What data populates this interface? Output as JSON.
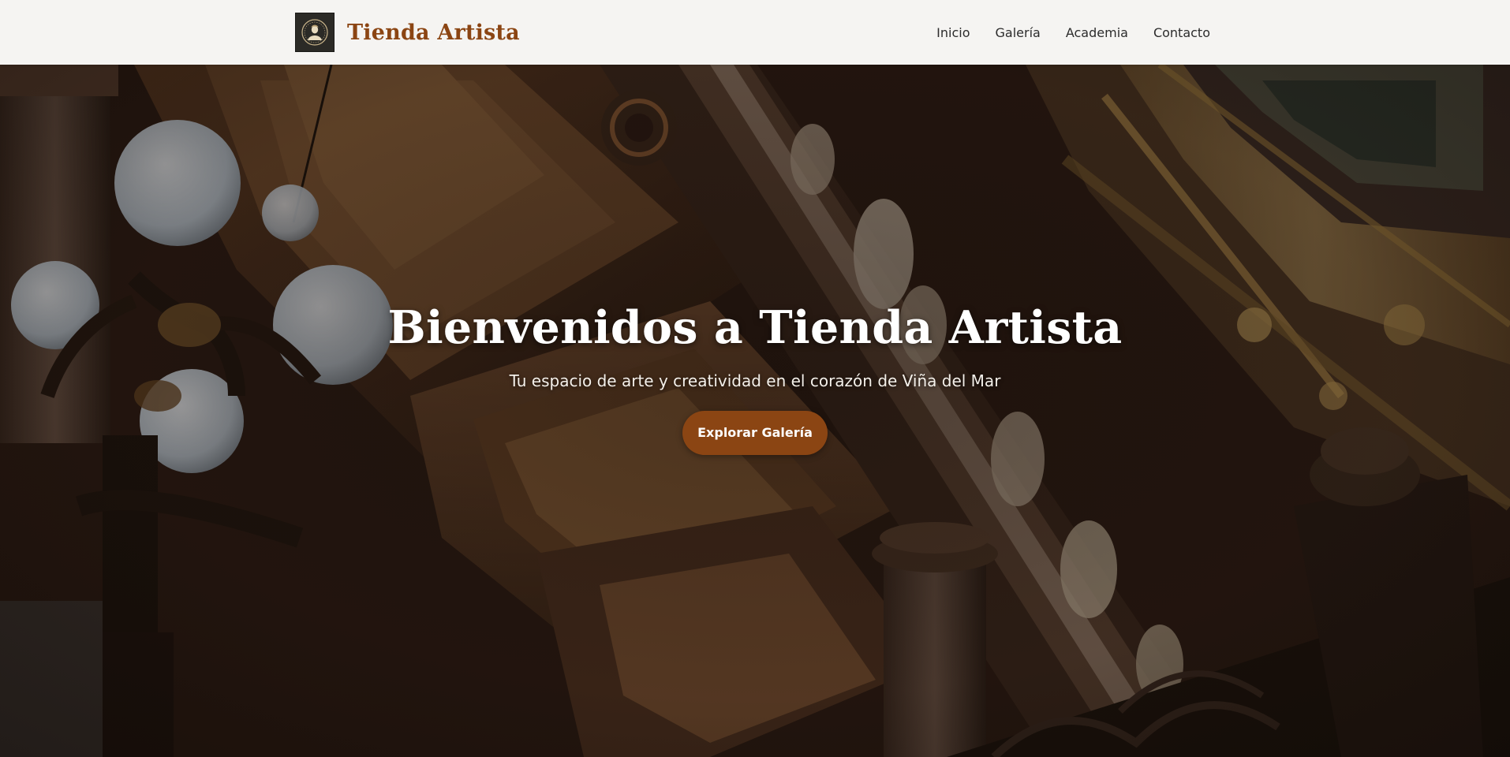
{
  "header": {
    "brand_name": "Tienda Artista",
    "logo_icon": "cameo-portrait-logo",
    "nav": [
      {
        "label": "Inicio"
      },
      {
        "label": "Galería"
      },
      {
        "label": "Academia"
      },
      {
        "label": "Contacto"
      }
    ]
  },
  "hero": {
    "title": "Bienvenidos a Tienda Artista",
    "subtitle": "Tu espacio de arte y creatividad en el corazón de Viña del Mar",
    "cta_label": "Explorar Galería"
  },
  "colors": {
    "brand": "#8b4513",
    "header_bg": "#f5f4f2",
    "nav_text": "#2c2c2c",
    "hero_text": "#ffffff"
  }
}
